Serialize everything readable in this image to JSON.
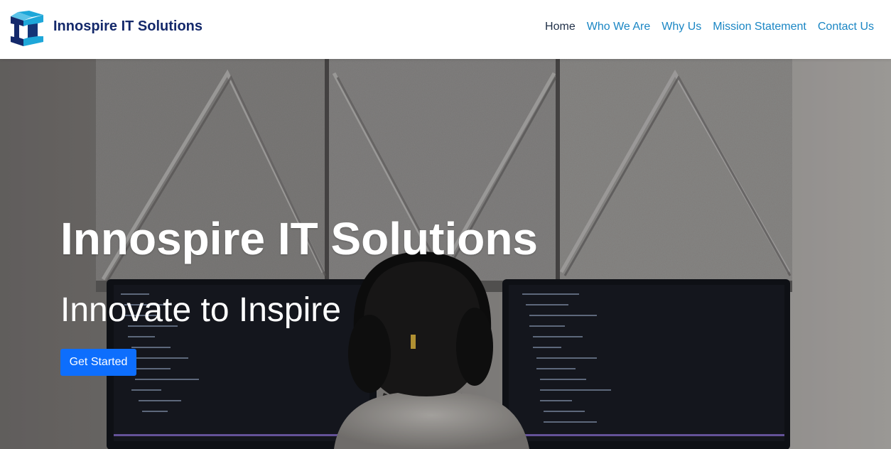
{
  "brand": {
    "name": "Innospire IT Solutions",
    "logo_icon": "cube-logo-icon",
    "colors": {
      "dark": "#14296b",
      "light": "#1ea7d9"
    }
  },
  "nav": {
    "items": [
      {
        "label": "Home",
        "active": true
      },
      {
        "label": "Who We Are",
        "active": false
      },
      {
        "label": "Why Us",
        "active": false
      },
      {
        "label": "Mission Statement",
        "active": false
      },
      {
        "label": "Contact Us",
        "active": false
      }
    ],
    "link_color": "#1a86c4",
    "active_color": "#1f2f47"
  },
  "hero": {
    "title": "Innospire IT Solutions",
    "subtitle": "Innovate to Inspire",
    "cta_label": "Get Started",
    "cta_color": "#0d6efd",
    "background": "photo of a person wearing headphones working at two monitors in front of grey acoustic wall panels"
  }
}
